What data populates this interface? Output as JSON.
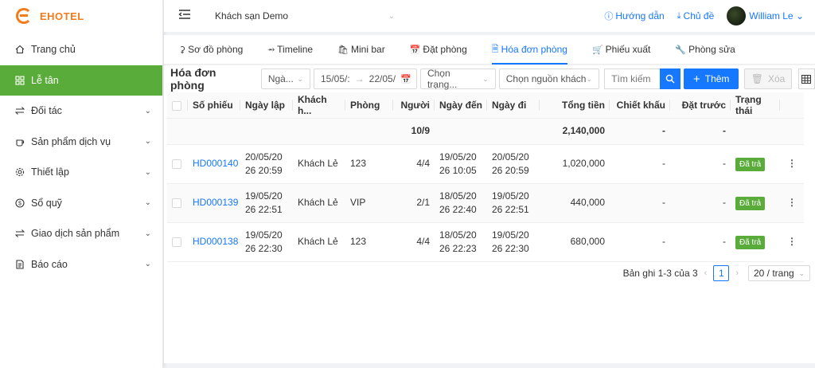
{
  "app": {
    "name": "EHOTEL",
    "brand_color": "#f07c1e",
    "accent": "#1677ff",
    "active_green": "#5aac3a"
  },
  "sidebar": {
    "items": [
      {
        "label": "Trang chủ",
        "icon": "home-icon",
        "has_children": false,
        "active": false
      },
      {
        "label": "Lễ tân",
        "icon": "grid-icon",
        "has_children": false,
        "active": true
      },
      {
        "label": "Đối tác",
        "icon": "swap-icon",
        "has_children": true,
        "active": false
      },
      {
        "label": "Sản phẩm dịch vụ",
        "icon": "cup-icon",
        "has_children": true,
        "active": false
      },
      {
        "label": "Thiết lập",
        "icon": "gear-icon",
        "has_children": true,
        "active": false
      },
      {
        "label": "Sổ quỹ",
        "icon": "dollar-icon",
        "has_children": true,
        "active": false
      },
      {
        "label": "Giao dịch sản phẩm",
        "icon": "swap-icon",
        "has_children": true,
        "active": false
      },
      {
        "label": "Báo cáo",
        "icon": "report-icon",
        "has_children": true,
        "active": false
      }
    ]
  },
  "header": {
    "hotel": "Khách sạn Demo",
    "help": "Hướng dẫn",
    "theme": "Chủ đề",
    "user": "William Le"
  },
  "tabs": [
    {
      "label": "Sơ đồ phòng",
      "icon": "diagram-icon",
      "active": false
    },
    {
      "label": "Timeline",
      "icon": "timeline-icon",
      "active": false
    },
    {
      "label": "Mini bar",
      "icon": "bag-icon",
      "active": false
    },
    {
      "label": "Đặt phòng",
      "icon": "calendar-icon",
      "active": false
    },
    {
      "label": "Hóa đơn phòng",
      "icon": "invoice-icon",
      "active": true
    },
    {
      "label": "Phiếu xuất",
      "icon": "cart-icon",
      "active": false
    },
    {
      "label": "Phòng sửa",
      "icon": "wrench-icon",
      "active": false
    }
  ],
  "toolbar": {
    "title": "Hóa đơn phòng",
    "date_type": "Ngà...",
    "date_from": "15/05/:",
    "date_to": "22/05/",
    "status_placeholder": "Chọn trạng...",
    "source_placeholder": "Chọn nguồn khách",
    "search_placeholder": "Tìm kiếm",
    "add_label": "Thêm",
    "delete_label": "Xóa"
  },
  "table": {
    "columns": [
      "Số phiếu",
      "Ngày lập",
      "Khách h...",
      "Phòng",
      "Người",
      "Ngày đến",
      "Ngày đi",
      "Tổng tiền",
      "Chiết khấu",
      "Đặt trước",
      "Trạng thái"
    ],
    "summary": {
      "guests": "10/9",
      "total": "2,140,000",
      "discount": "-",
      "deposit": "-"
    },
    "rows": [
      {
        "code": "HD000140",
        "created_1": "20/05/20",
        "created_2": "26 20:59",
        "customer": "Khách Lẻ",
        "room": "123",
        "guests": "4/4",
        "arrive_1": "19/05/20",
        "arrive_2": "26 10:05",
        "depart_1": "20/05/20",
        "depart_2": "26 20:59",
        "total": "1,020,000",
        "discount": "-",
        "deposit": "-",
        "status": "Đã trả"
      },
      {
        "code": "HD000139",
        "created_1": "19/05/20",
        "created_2": "26 22:51",
        "customer": "Khách Lẻ",
        "room": "VIP",
        "guests": "2/1",
        "arrive_1": "18/05/20",
        "arrive_2": "26 22:40",
        "depart_1": "19/05/20",
        "depart_2": "26 22:51",
        "total": "440,000",
        "discount": "-",
        "deposit": "-",
        "status": "Đã trả"
      },
      {
        "code": "HD000138",
        "created_1": "19/05/20",
        "created_2": "26 22:30",
        "customer": "Khách Lẻ",
        "room": "123",
        "guests": "4/4",
        "arrive_1": "18/05/20",
        "arrive_2": "26 22:23",
        "depart_1": "19/05/20",
        "depart_2": "26 22:30",
        "total": "680,000",
        "discount": "-",
        "deposit": "-",
        "status": "Đã trả"
      }
    ]
  },
  "pagination": {
    "summary": "Bản ghi 1-3 của 3",
    "current_page": "1",
    "page_size": "20 / trang"
  }
}
